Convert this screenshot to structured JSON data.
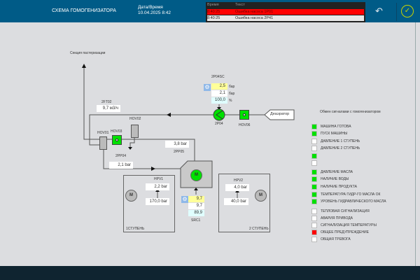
{
  "header": {
    "title": "СХЕМА ГОМОГЕНИЗАТОРА",
    "datetime_label": "Дата/Время",
    "datetime_value": "10.04.2025 8:42"
  },
  "alarms": {
    "col_time": "Время",
    "col_text": "Текст",
    "rows": [
      {
        "time": "8:40:25",
        "text": "Ошибка насоса 1P01",
        "active": true
      },
      {
        "time": "8:40:25",
        "text": "Ошибка насоса 2P41",
        "active": false
      }
    ]
  },
  "icons": {
    "back": "back-arrow-icon",
    "confirm": "check-circle-icon",
    "settings": "gear-icon"
  },
  "colors": {
    "header": "#005b87",
    "active_signal": "#00e000",
    "alarm": "#ff0000"
  },
  "scheme": {
    "pasteurization": "Секция пастеризации",
    "deaerator": "Деаэратор",
    "flow": {
      "tag": "2FT02",
      "value": "9,7 м3/ч"
    },
    "pump_sc": {
      "tag": "2P04SC",
      "v1": "2,5",
      "u1": "бар",
      "v2": "2,1",
      "u2": "бар",
      "v3": "100,0",
      "u3": "%"
    },
    "pump": "2P04",
    "hov06": "HOV06",
    "hov01": "HOV01",
    "hov02": "HOV02",
    "hov03": "HOV03",
    "pp04": {
      "tag": "2PP04",
      "value": "2,1 bar"
    },
    "pp05": {
      "tag": "2PP05",
      "value": "3,8 bar"
    },
    "motor": "M",
    "src1": {
      "tag": "SRC1",
      "v1": "9,7",
      "v2": "9,7",
      "v3": "89,9"
    },
    "hpv1": {
      "tag": "HPV1",
      "v1": "2,2 bar",
      "v2": "170,0 bar",
      "stage": "1СТУПЕНЬ"
    },
    "hpv2": {
      "tag": "HPV2",
      "v1": "4,0 bar",
      "v2": "40,0 bar",
      "stage": "2 СТУПЕНЬ"
    }
  },
  "signals": {
    "title": "Обмен сигналами с гомогенизатором",
    "items": [
      {
        "label": "МАШИНА ГОТОВА",
        "state": "green"
      },
      {
        "label": "ПУСК МАШИНЫ",
        "state": "green"
      },
      {
        "label": "ДАВЛЕНИЕ 1 СТУПЕНЬ",
        "state": "off"
      },
      {
        "label": "ДАВЛЕНИЕ 2 СТУПЕНЬ",
        "state": "off"
      },
      {
        "label": "",
        "state": "green"
      },
      {
        "label": "",
        "state": "off"
      },
      {
        "label": "ДАВЛЕНИЕ МАСЛА",
        "state": "green"
      },
      {
        "label": "НАЛИЧИЕ ВОДЫ",
        "state": "green"
      },
      {
        "label": "НАЛИЧИЕ ПРОДУКТА",
        "state": "green"
      },
      {
        "label": "ТЕМПЕРАТУРА ГИДР-ГО МАСЛА ОК",
        "state": "green"
      },
      {
        "label": "УРОВЕНЬ ГИДРАВЛИЧЕСКОГО МАСЛА",
        "state": "green"
      },
      {
        "label": "ТЕПЛОВАЯ СИГНАЛИЗАЦИЯ",
        "state": "off"
      },
      {
        "label": "АВАРИЯ ПРИВОДА",
        "state": "off"
      },
      {
        "label": "СИГНАЛИЗАЦИЯ ТЕМПЕРАТУРЫ",
        "state": "off"
      },
      {
        "label": "ОБЩЕЕ ПРЕДУПРЕЖДЕНИЕ",
        "state": "red"
      },
      {
        "label": "ОБЩАЯ ТРЕВОГА",
        "state": "off"
      }
    ]
  }
}
